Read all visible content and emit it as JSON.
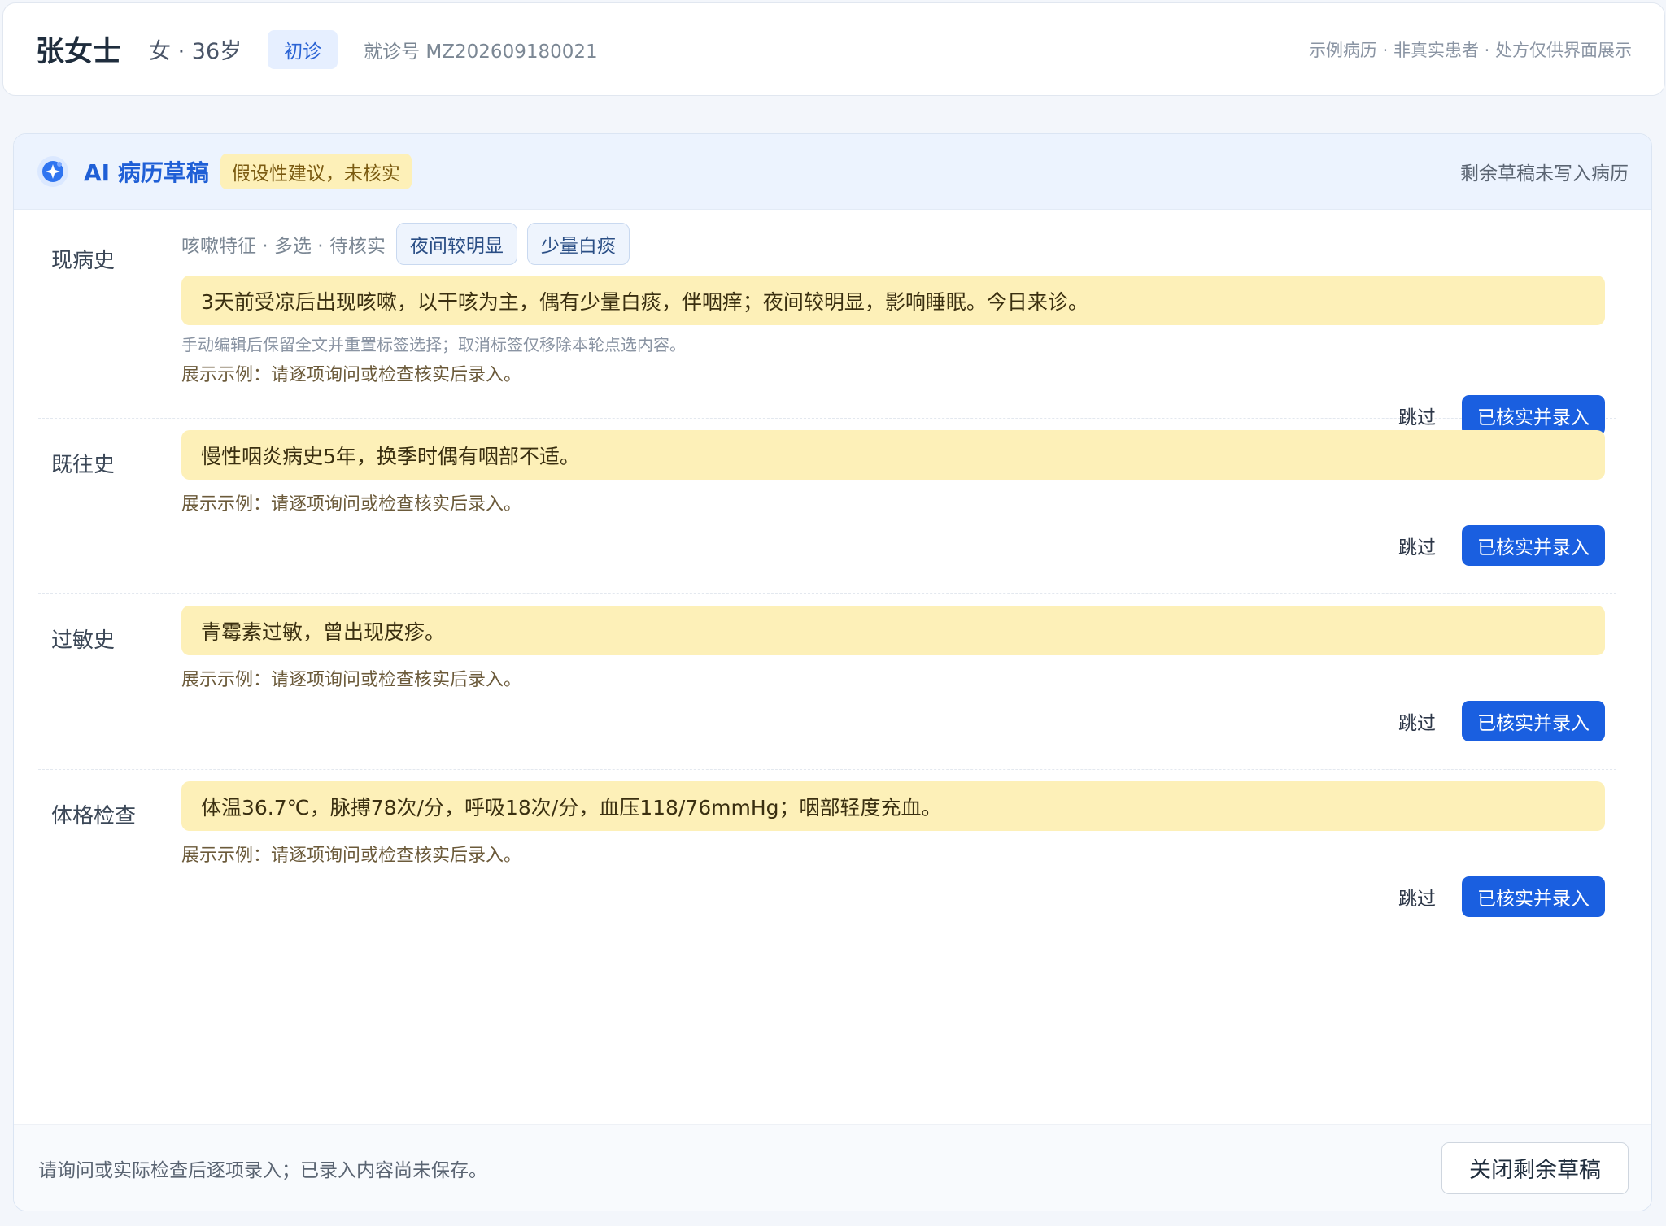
{
  "patient": {
    "name": "张女士",
    "meta": "女 · 36岁",
    "visit_type": "初诊",
    "visit_no": "就诊号 MZ202609180021",
    "disclaimer": "示例病历 · 非真实患者 · 处方仅供界面展示"
  },
  "panel": {
    "title": "AI 病历草稿",
    "warning": "假设性建议，未核实",
    "status": "剩余草稿未写入病历",
    "accent": "#1a5fe0",
    "draft_bg": "#fdf0b8"
  },
  "sections": [
    {
      "label": "现病史",
      "chip_hint": "咳嗽特征 · 多选 · 待核实",
      "chips": [
        "夜间较明显",
        "少量白痰"
      ],
      "text": "3天前受凉后出现咳嗽，以干咳为主，偶有少量白痰，伴咽痒；夜间较明显，影响睡眠。今日来诊。",
      "note": "手动编辑后保留全文并重置标签选择；取消标签仅移除本轮点选内容。",
      "example": "展示示例：请逐项询问或检查核实后录入。",
      "skip": "跳过",
      "confirm": "已核实并录入"
    },
    {
      "label": "既往史",
      "text": "慢性咽炎病史5年，换季时偶有咽部不适。",
      "example": "展示示例：请逐项询问或检查核实后录入。",
      "skip": "跳过",
      "confirm": "已核实并录入"
    },
    {
      "label": "过敏史",
      "text": "青霉素过敏，曾出现皮疹。",
      "example": "展示示例：请逐项询问或检查核实后录入。",
      "skip": "跳过",
      "confirm": "已核实并录入"
    },
    {
      "label": "体格检查",
      "text": "体温36.7℃，脉搏78次/分，呼吸18次/分，血压118/76mmHg；咽部轻度充血。",
      "example": "展示示例：请逐项询问或检查核实后录入。",
      "skip": "跳过",
      "confirm": "已核实并录入"
    }
  ],
  "footer": {
    "note": "请询问或实际检查后逐项录入；已录入内容尚未保存。",
    "close": "关闭剩余草稿"
  }
}
